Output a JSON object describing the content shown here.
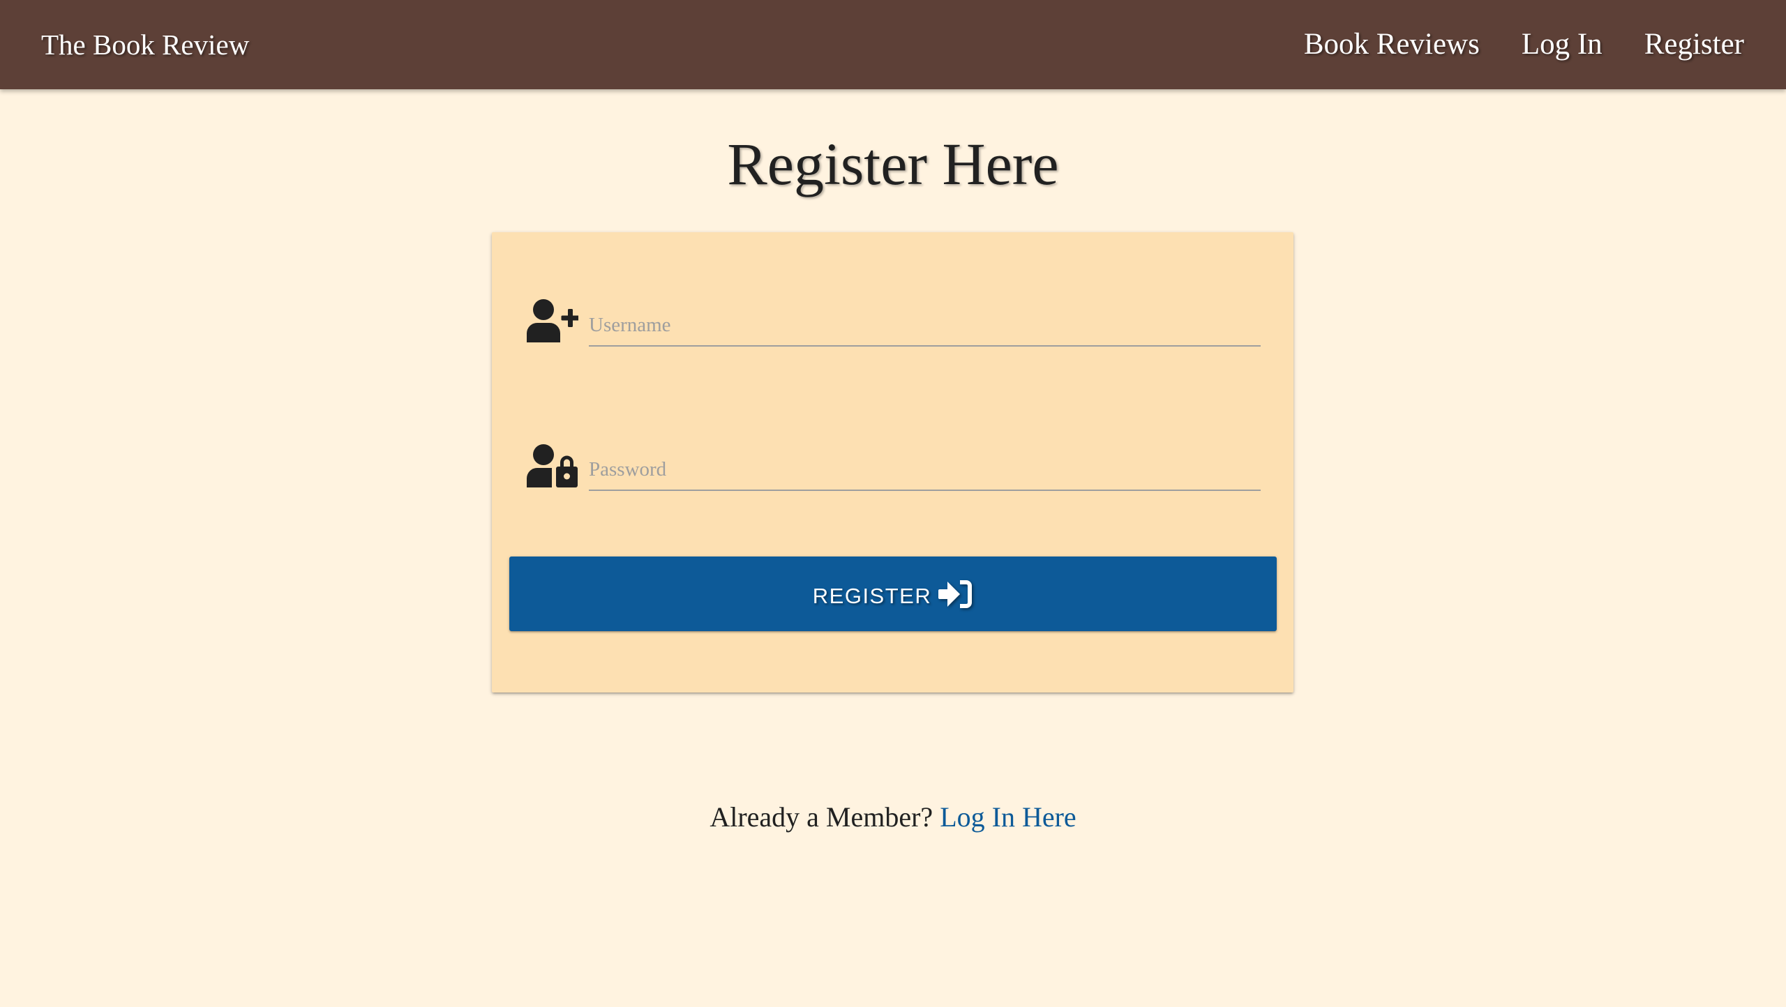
{
  "nav": {
    "brand": "The Book Review",
    "links": [
      {
        "label": "Book Reviews"
      },
      {
        "label": "Log In"
      },
      {
        "label": "Register"
      }
    ]
  },
  "page": {
    "title": "Register Here"
  },
  "form": {
    "username": {
      "placeholder": "Username",
      "value": "",
      "icon": "user-plus-icon"
    },
    "password": {
      "placeholder": "Password",
      "value": "",
      "icon": "user-lock-icon"
    },
    "submit": {
      "label": "REGISTER",
      "icon": "sign-in-icon"
    }
  },
  "footer": {
    "prompt": "Already a Member?",
    "link_label": "Log In Here"
  },
  "colors": {
    "navbar": "#5d4037",
    "background": "#fff3e0",
    "card": "#fde0b2",
    "button": "#0d5a98",
    "link": "#0d5a98"
  }
}
